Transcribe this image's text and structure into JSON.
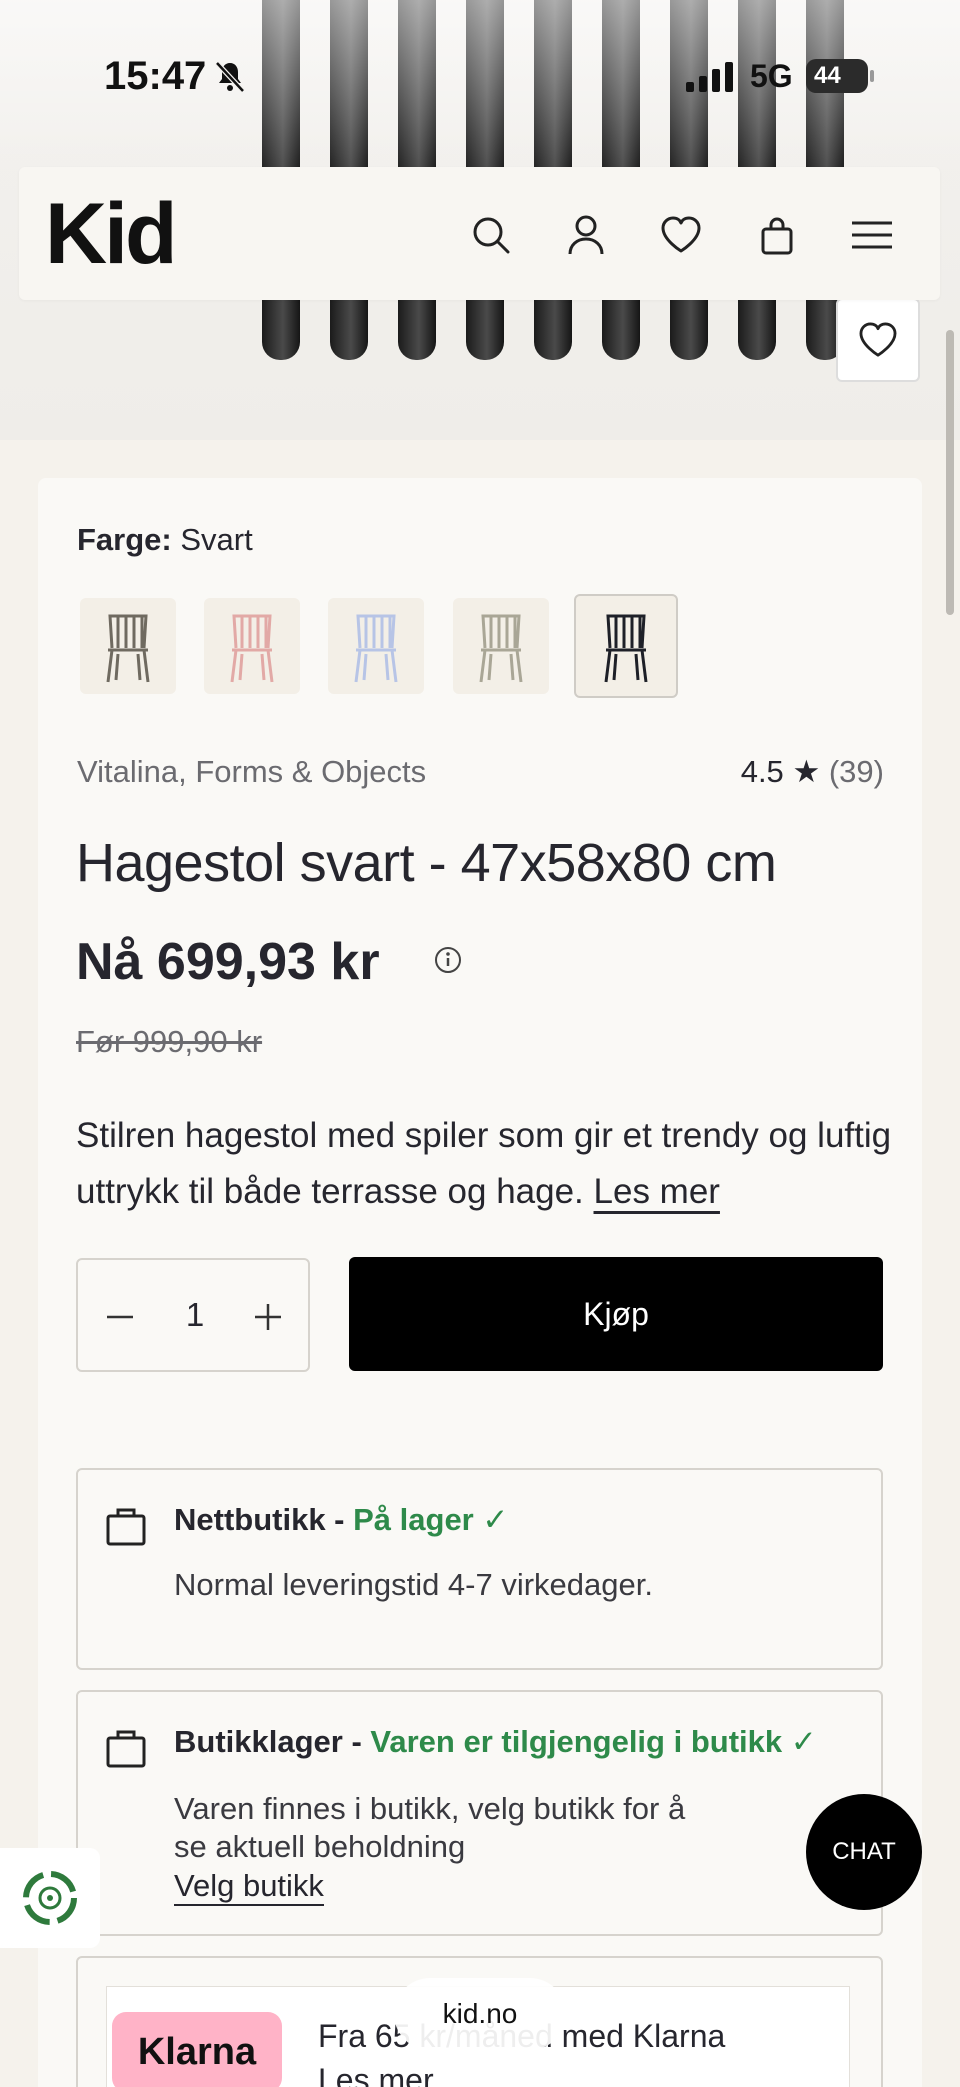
{
  "status_bar": {
    "time": "15:47",
    "network": "5G",
    "battery": "44"
  },
  "header": {
    "logo": "Kid"
  },
  "product": {
    "color_label": "Farge:",
    "color_value": "Svart",
    "swatches": [
      "grå",
      "rosa",
      "blå",
      "sand",
      "svart"
    ],
    "brand": "Vitalina, Forms & Objects",
    "rating": "4.5",
    "rating_star": "★",
    "review_count": "(39)",
    "title": "Hagestol svart - 47x58x80 cm",
    "price_now": "Nå 699,93 kr",
    "price_before": "Før 999,90 kr",
    "description": "Stilren hagestol med spiler som gir et trendy og luftig uttrykk til både terrasse og hage.",
    "read_more": "Les mer",
    "quantity": "1",
    "buy_label": "Kjøp"
  },
  "stock_online": {
    "title": "Nettbutikk - ",
    "status": "På lager ✓",
    "body": "Normal leveringstid 4-7 virkedager."
  },
  "stock_store": {
    "title": "Butikklager - ",
    "status": "Varen er tilgjengelig i butikk ✓",
    "body_line1": "Varen finnes i butikk, velg butikk for å",
    "body_line2": "se aktuell beholdning",
    "link": "Velg butikk"
  },
  "klarna": {
    "logo": "Klarna",
    "text": "Fra 65 kr/måned med Klarna",
    "link": "Les mer"
  },
  "chat": {
    "label": "CHAT"
  },
  "browser": {
    "url": "kid.no"
  },
  "colors": {
    "accent_green": "#2e8a4a",
    "buy_bg": "#000000",
    "klarna_pink": "#ffb3c7"
  }
}
